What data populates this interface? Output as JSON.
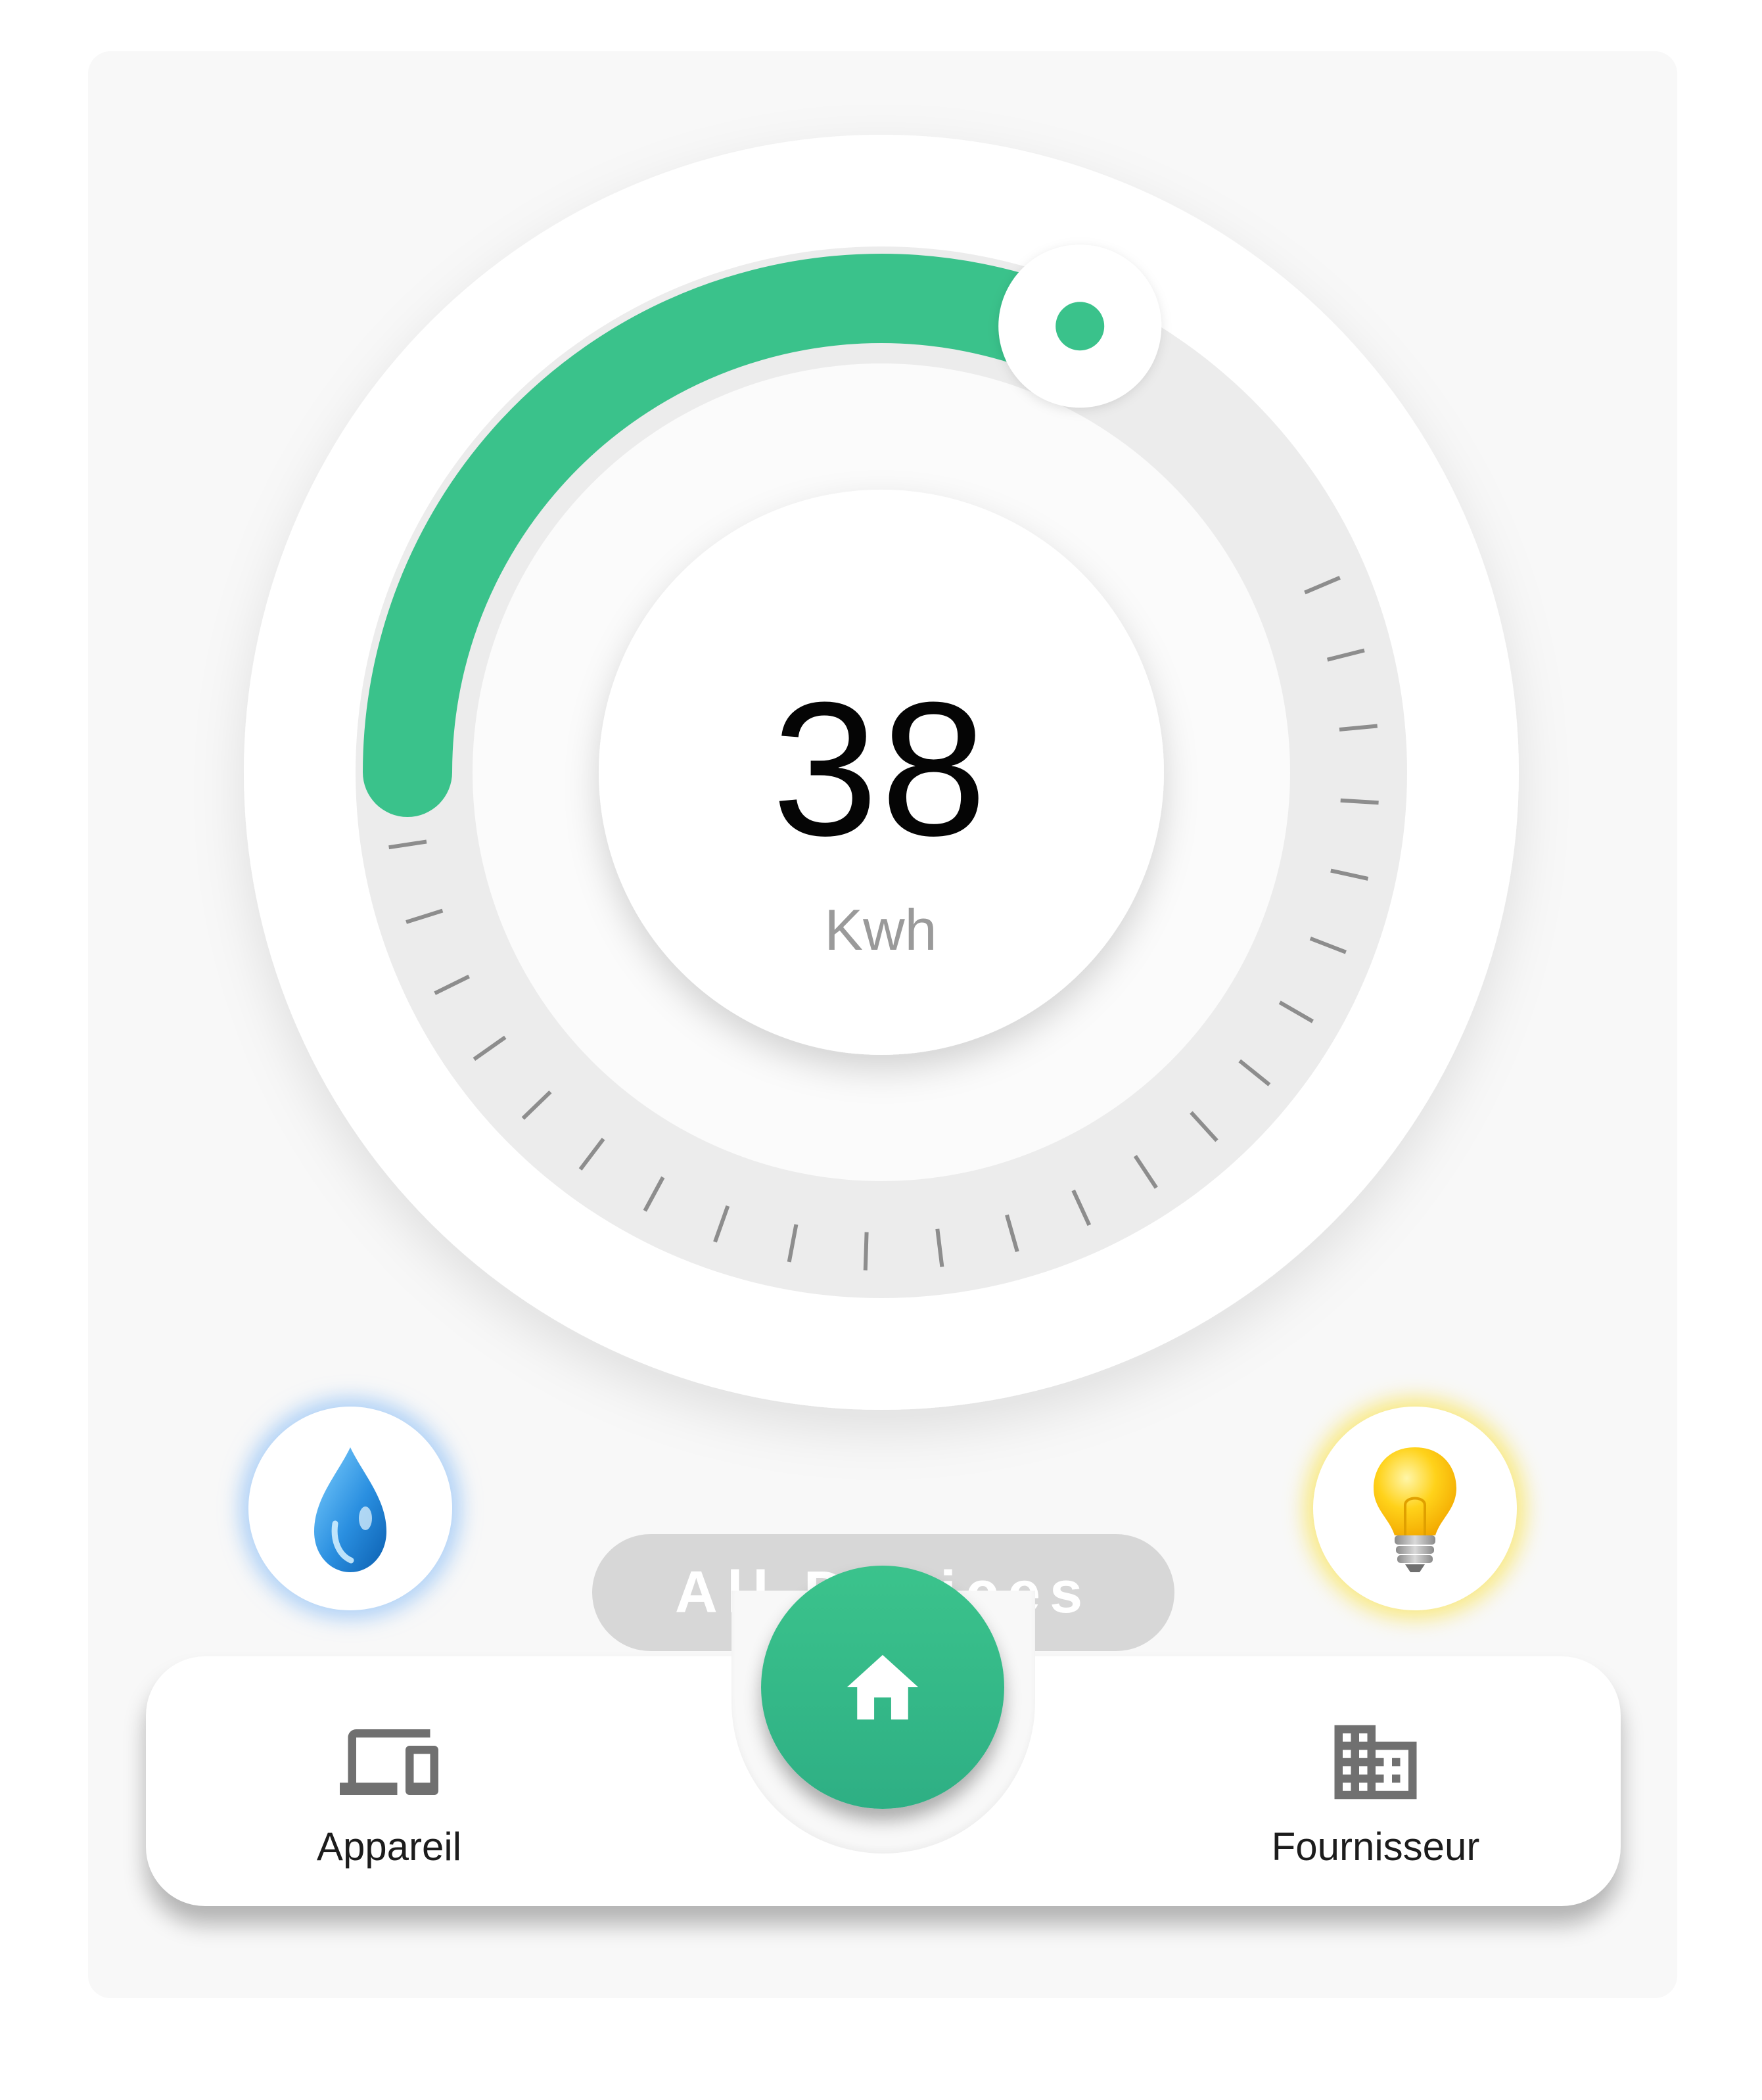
{
  "meter": {
    "value": "38",
    "unit": "Kwh",
    "progress_fraction": 0.38,
    "accent_color": "#3ac28b",
    "track_color": "#ececec",
    "tick_count": 25
  },
  "quick_actions": {
    "water_icon": "water-drop-icon",
    "bulb_icon": "light-bulb-icon"
  },
  "filter_pill": {
    "label": "All Devices"
  },
  "bottom_nav": {
    "items": [
      {
        "label": "Appareil",
        "icon": "devices-icon"
      },
      {
        "label": "Fournisseur",
        "icon": "building-icon"
      }
    ],
    "center_icon": "home-icon",
    "center_color": "#35bb88"
  }
}
